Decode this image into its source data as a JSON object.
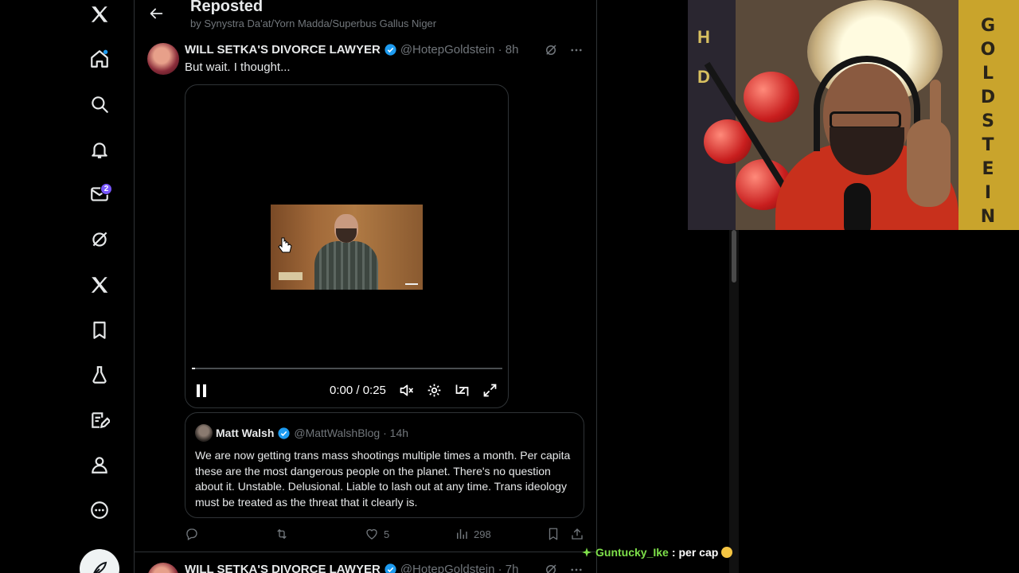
{
  "nav": {
    "messages_badge": "2"
  },
  "header": {
    "title": "Reposted",
    "subtitle": "by Synystra Da'at/Yorn Madda/Superbus Gallus Niger"
  },
  "tweet": {
    "author_name": "WILL SETKA'S DIVORCE LAWYER",
    "meta": "@HotepGoldstein · 8h",
    "text": "But wait. I thought...",
    "video": {
      "time": "0:00 / 0:25",
      "progress": 0.01
    },
    "quote": {
      "author_name": "Matt Walsh",
      "meta": "@MattWalshBlog · 14h",
      "text": "We are now getting trans mass shootings multiple times a month. Per capita these are the most dangerous people on the planet. There's no question about it. Unstable. Delusional. Liable to lash out at any time. Trans ideology must be treated as the threat that it clearly is."
    },
    "actions": {
      "likes": "5",
      "views": "298"
    }
  },
  "tweet2": {
    "author_name": "WILL SETKA'S DIVORCE LAWYER",
    "meta": "@HotepGoldstein · 7h"
  },
  "webcam": {
    "banner_right": "GOLDSTEIN",
    "banner_left": "HD"
  },
  "chat": {
    "user": "Guntucky_Ike",
    "separator": ":",
    "message": "per cap"
  },
  "colors": {
    "accent": "#1d9bf0",
    "badge": "#7856ff",
    "chat_user": "#7ee04a"
  }
}
